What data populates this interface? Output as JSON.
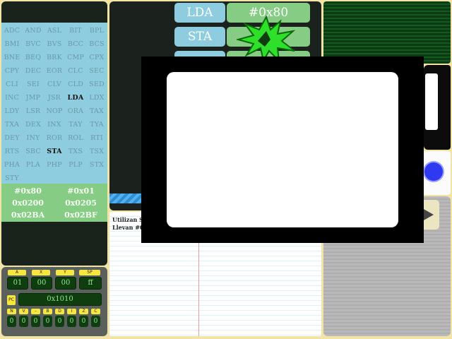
{
  "opcodes": [
    "ADC",
    "AND",
    "ASL",
    "BIT",
    "BPL",
    "BMI",
    "BVC",
    "BVS",
    "BCC",
    "BCS",
    "BNE",
    "BEQ",
    "BRK",
    "CMP",
    "CPX",
    "CPY",
    "DEC",
    "EOR",
    "CLC",
    "SEC",
    "CLI",
    "SEI",
    "CLV",
    "CLD",
    "SED",
    "INC",
    "JMP",
    "JSR",
    "LDA",
    "LDX",
    "LDY",
    "LSR",
    "NOP",
    "ORA",
    "TAX",
    "TXA",
    "DEX",
    "INX",
    "TAY",
    "TYA",
    "DEY",
    "INY",
    "ROR",
    "ROL",
    "RTI",
    "RTS",
    "SBC",
    "STA",
    "TXS",
    "TSX",
    "PHA",
    "PLA",
    "PHP",
    "PLP",
    "STX",
    "STY"
  ],
  "highlighted_opcodes": [
    "LDA",
    "STA"
  ],
  "addresses": [
    "#0x80",
    "#0x01",
    "0x0200",
    "0x0205",
    "0x02BA",
    "0x02BF"
  ],
  "instructions": [
    {
      "op": "LDA",
      "arg": "#0x80"
    },
    {
      "op": "STA",
      "arg": ""
    }
  ],
  "registers": {
    "labels": [
      "A",
      "X",
      "Y",
      "SP"
    ],
    "values": [
      "01",
      "00",
      "00",
      "ff"
    ],
    "pc_label": "PC",
    "pc_value": "0x1010",
    "flag_labels": [
      "N",
      "V",
      "-",
      "B",
      "D",
      "I",
      "Z",
      "C"
    ],
    "flag_values": [
      "0",
      "0",
      "0",
      "0",
      "0",
      "0",
      "0",
      "0"
    ]
  },
  "notes": {
    "line1": "Utilizan S",
    "line2": "Llevan #0"
  },
  "colors": {
    "opcode_bg": "#8ecde0",
    "address_bg": "#86cc84",
    "register_label": "#f6e640",
    "register_value": "#0f3d10",
    "modal": "#000000"
  },
  "icons": {
    "burst": "green-burst-icon",
    "play": "play-icon",
    "record": "blue-circle-icon"
  }
}
